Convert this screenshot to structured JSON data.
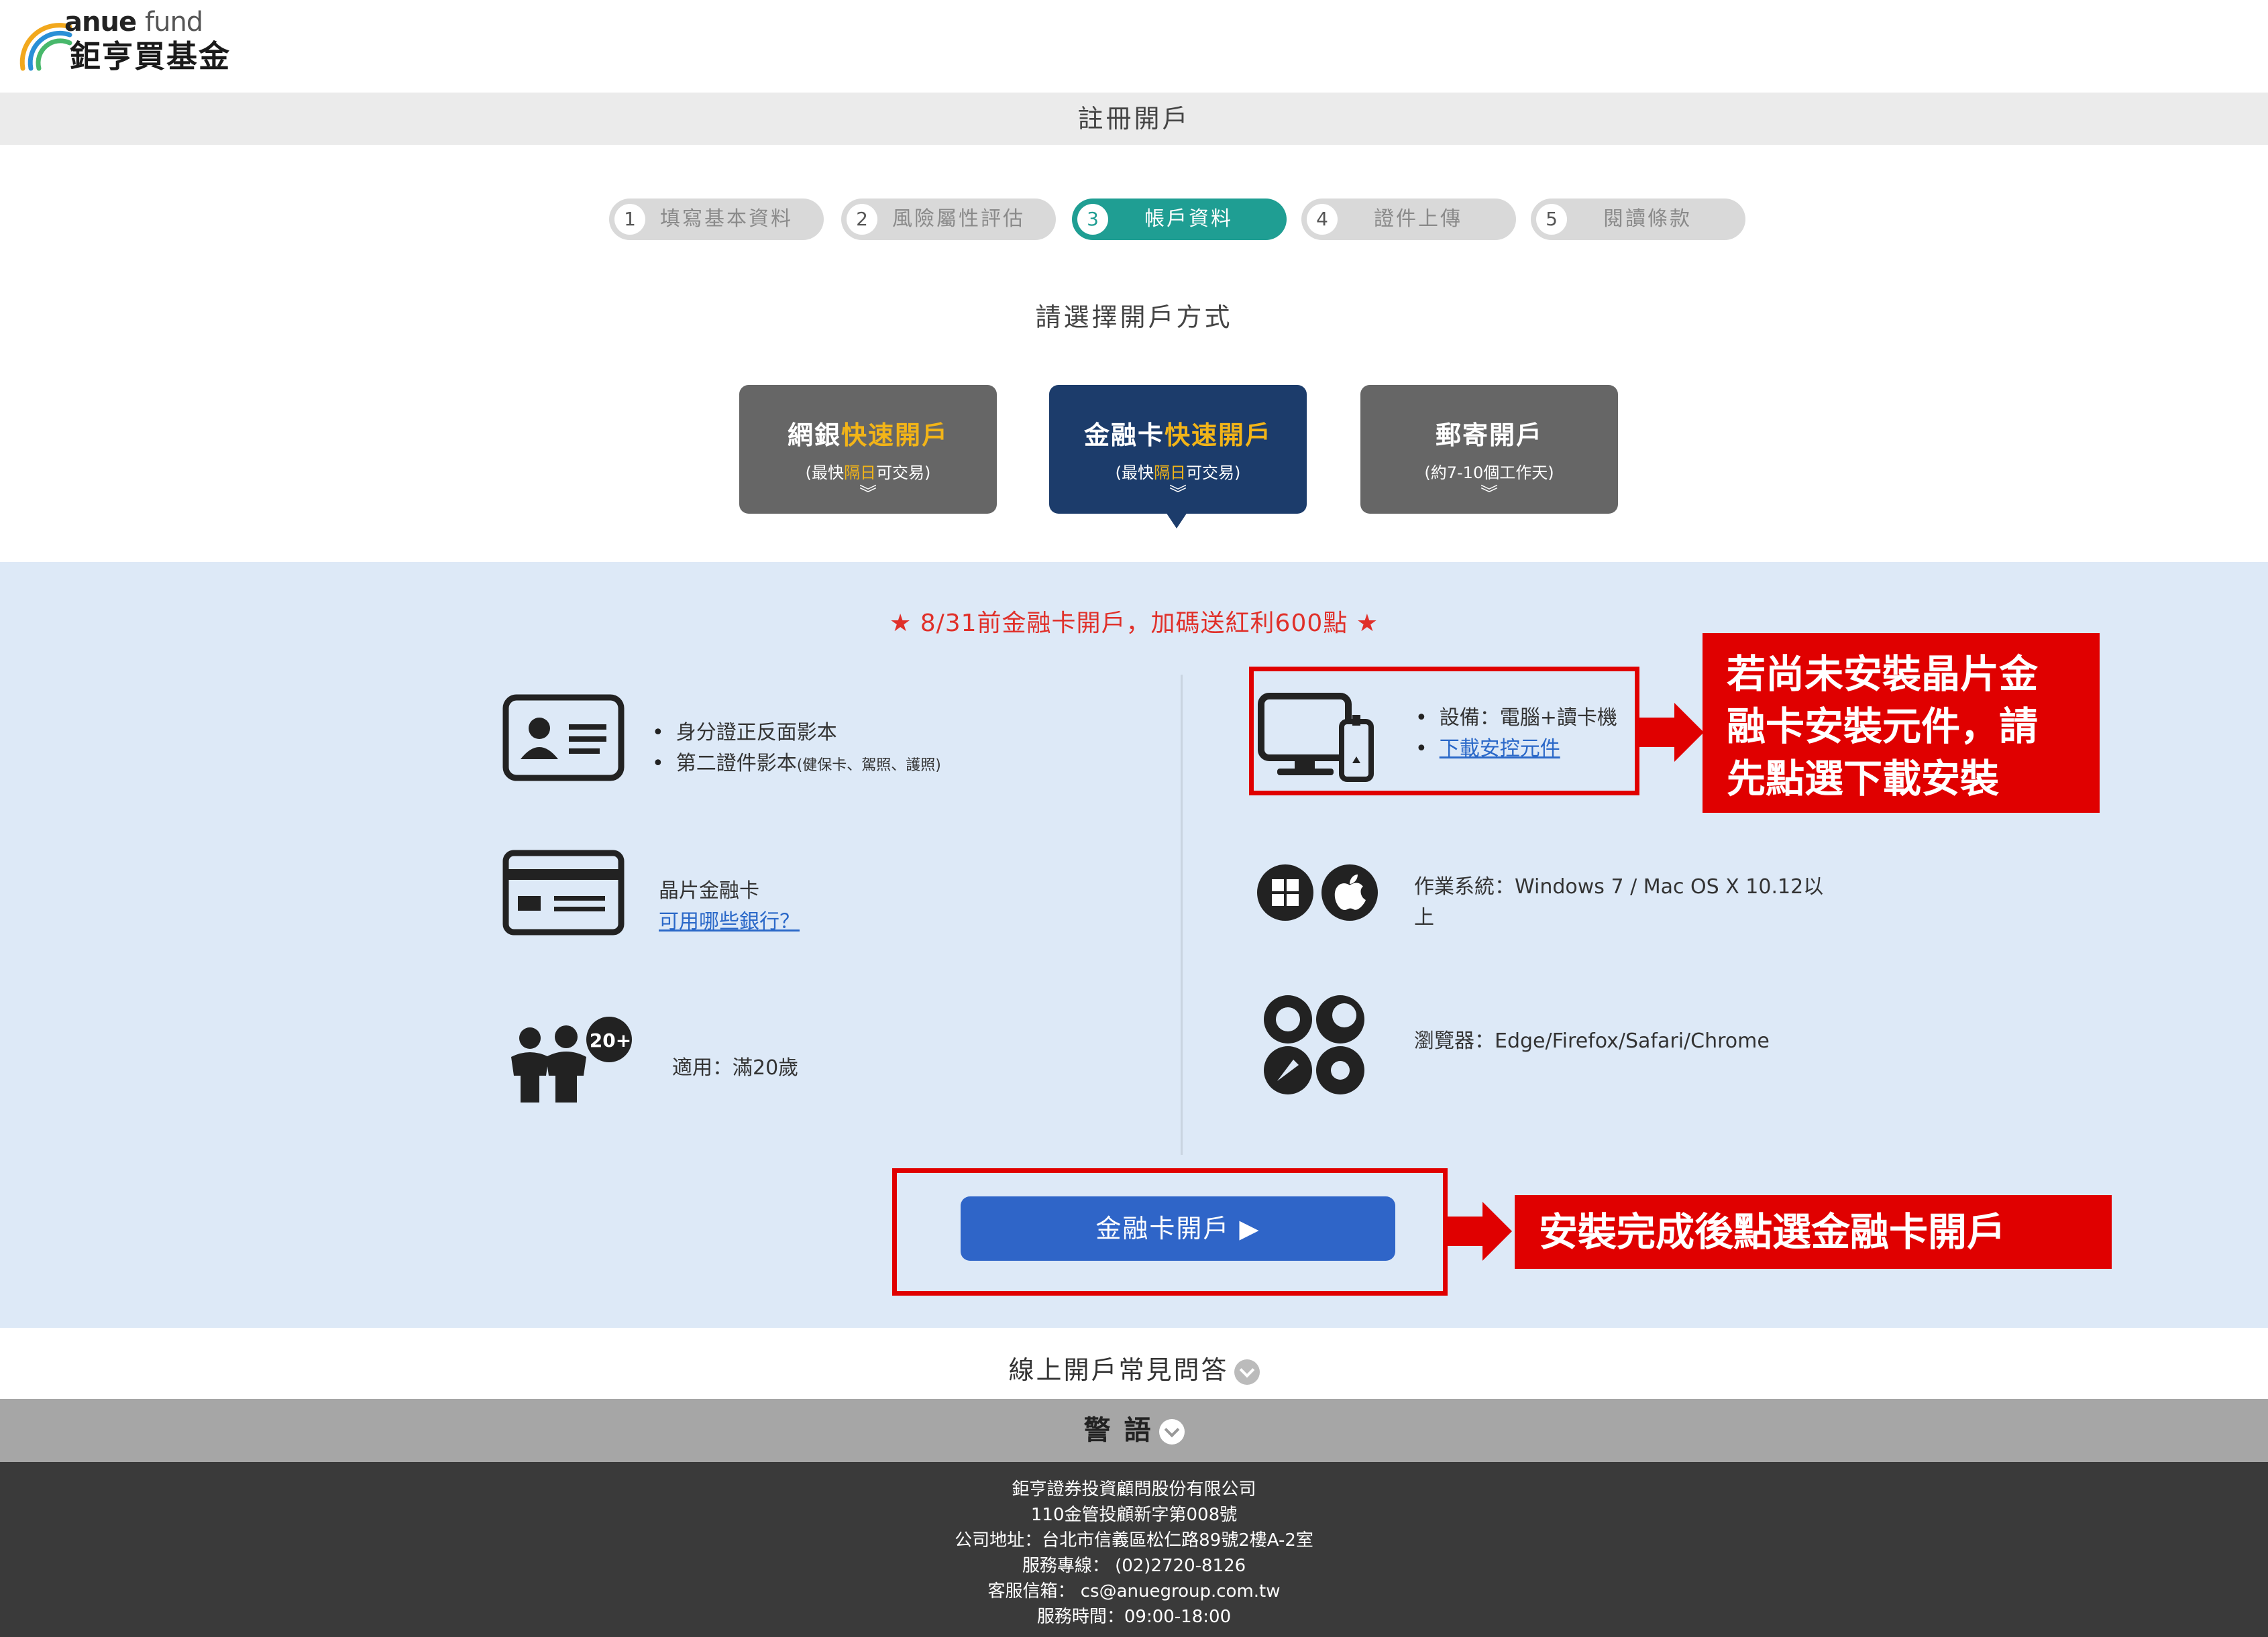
{
  "header": {
    "logo_word": "anue",
    "logo_word2": "fund",
    "logo_cn": "鉅亨買基金"
  },
  "page_title": "註冊開戶",
  "steps": [
    {
      "num": "1",
      "label": "填寫基本資料"
    },
    {
      "num": "2",
      "label": "風險屬性評估"
    },
    {
      "num": "3",
      "label": "帳戶資料"
    },
    {
      "num": "4",
      "label": "證件上傳"
    },
    {
      "num": "5",
      "label": "閱讀條款"
    }
  ],
  "subtitle": "請選擇開戶方式",
  "methods": [
    {
      "title_a": "網銀",
      "title_b": "快速開戶",
      "sub_a": "(最快",
      "sub_hl": "隔日",
      "sub_b": "可交易)",
      "chev": "︾"
    },
    {
      "title_a": "金融卡",
      "title_b": "快速開戶",
      "sub_a": "(最快",
      "sub_hl": "隔日",
      "sub_b": "可交易)",
      "chev": "︾"
    },
    {
      "title_a": "郵寄開戶",
      "sub_b": "(約7-10個工作天)",
      "chev": "︾"
    }
  ],
  "promo": "★ 8/31前金融卡開戶，加碼送紅利600點 ★",
  "left_reqs": {
    "id_line1": "身分證正反面影本",
    "id_line2": "第二證件影本",
    "id_line2_small": "(健保卡、駕照、護照)",
    "card_line1": "晶片金融卡",
    "card_link": "可用哪些銀行？",
    "age_line": "適用：滿20歲",
    "age_badge": "20+"
  },
  "right_reqs": {
    "device_line": "設備：電腦+讀卡機",
    "device_link": "下載安控元件",
    "os_line1": "作業系統：Windows 7 / Mac OS X 10.12以",
    "os_line2": "上",
    "browser_line": "瀏覽器：Edge/Firefox/Safari/Chrome"
  },
  "annotations": {
    "install_line1": "若尚未安裝晶片金",
    "install_line2": "融卡安裝元件，請",
    "install_line3": "先點選下載安裝",
    "after_install": "安裝完成後點選金融卡開戶"
  },
  "cta_label": "金融卡開戶 ▶",
  "faq_label": "線上開戶常見問答",
  "warning_label": "警語",
  "footer": {
    "company": "鉅亨證券投資顧問股份有限公司",
    "license": "110金管投顧新字第008號",
    "address": "公司地址：台北市信義區松仁路89號2樓A-2室",
    "hotline": "服務專線： (02)2720-8126",
    "email": "客服信箱： cs@anuegroup.com.tw",
    "hours": "服務時間：09:00-18:00"
  },
  "colors": {
    "accent_teal": "#1f9e93",
    "navy": "#1c3c6b",
    "cta_blue": "#2f65c8",
    "annotation_red": "#e00000",
    "panel_bg": "#dde9f7"
  }
}
